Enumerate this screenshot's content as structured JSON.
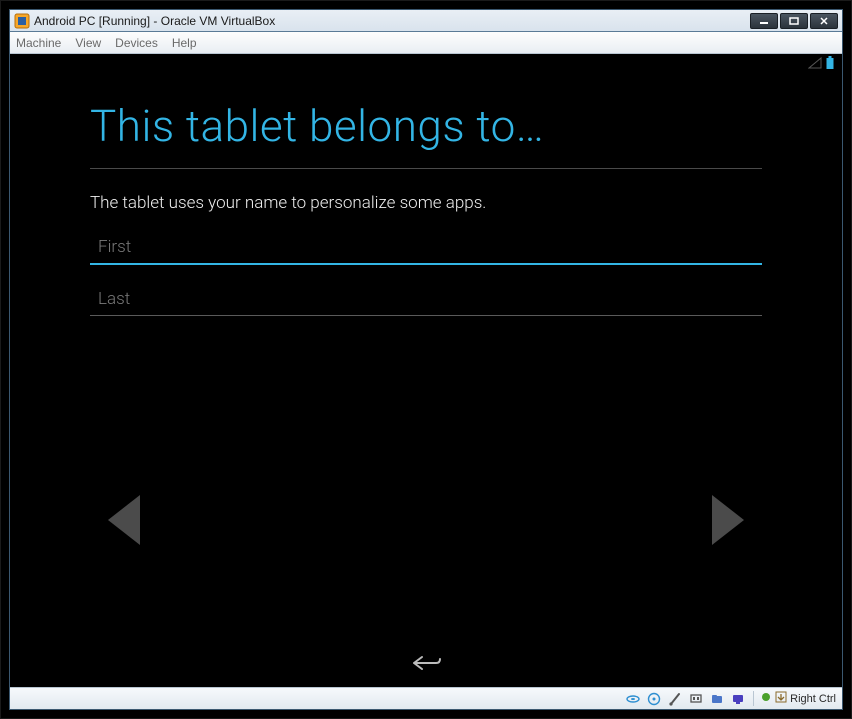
{
  "window": {
    "title": "Android PC [Running] - Oracle VM VirtualBox"
  },
  "menubar": {
    "machine": "Machine",
    "view": "View",
    "devices": "Devices",
    "help": "Help"
  },
  "setup": {
    "heading": "This tablet belongs to…",
    "description": "The tablet uses your name to personalize some apps.",
    "first_placeholder": "First",
    "last_placeholder": "Last",
    "first_value": "",
    "last_value": ""
  },
  "statusbar": {
    "hostkey_label": "Right Ctrl"
  },
  "colors": {
    "accent": "#33b5e5"
  }
}
